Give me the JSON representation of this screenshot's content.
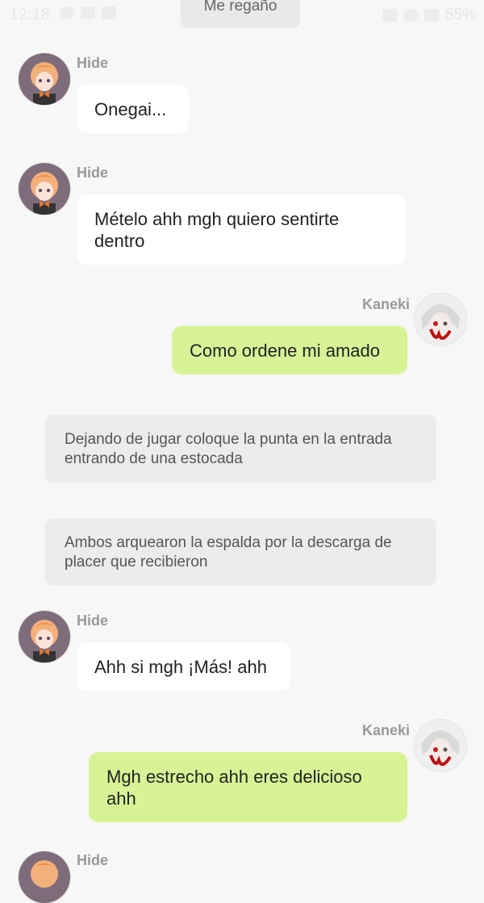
{
  "status_bar": {
    "time": "12:18",
    "battery": "55%"
  },
  "top_chip": "Me regaño",
  "messages": [
    {
      "sender": "Hide",
      "text": "Onegai..."
    },
    {
      "sender": "Hide",
      "text": "Mételo ahh mgh quiero sentirte dentro"
    },
    {
      "sender": "Kaneki",
      "text": "Como ordene mi amado"
    },
    {
      "narration": "Dejando de jugar coloque la punta en la entrada entrando de una estocada"
    },
    {
      "narration": "Ambos arquearon la espalda por la descarga de placer que recibieron"
    },
    {
      "sender": "Hide",
      "text": "Ahh si mgh ¡Más! ahh"
    },
    {
      "sender": "Kaneki",
      "text": "Mgh  estrecho ahh eres delicioso ahh"
    },
    {
      "sender": "Hide",
      "text": ""
    }
  ],
  "colors": {
    "background": "#f7f7f7",
    "bubble_left": "#ffffff",
    "bubble_right": "#d8f396",
    "narration": "#ececec",
    "sender_name": "#9a9a9a"
  },
  "icons": [
    "notification-icon",
    "folder-icon",
    "image-icon",
    "mute-icon",
    "wifi-icon",
    "signal-icon"
  ]
}
